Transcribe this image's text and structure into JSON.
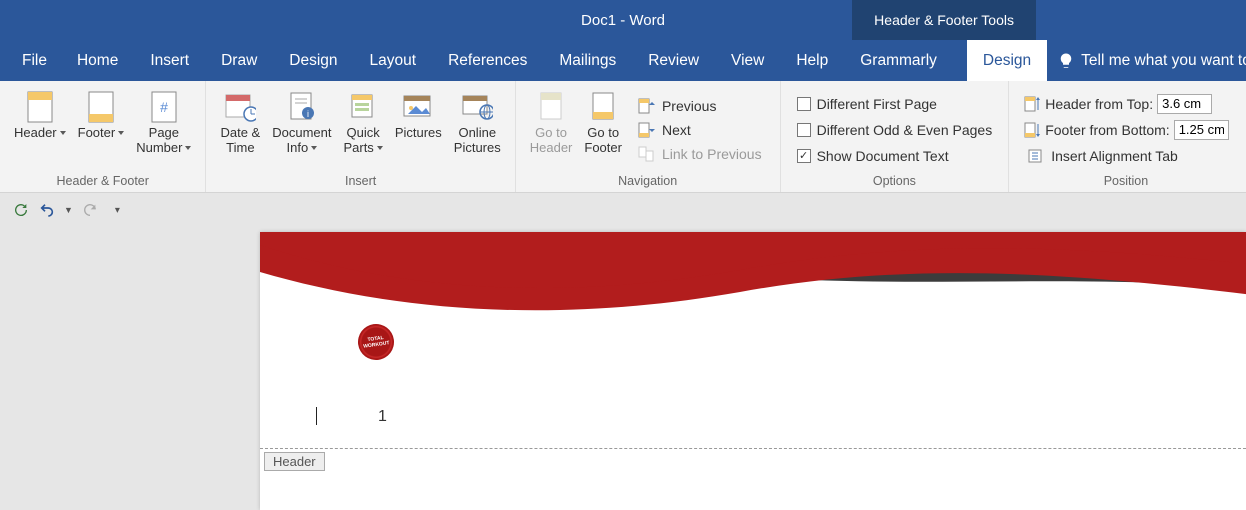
{
  "title": "Doc1  -  Word",
  "contextual_tab": "Header & Footer Tools",
  "tabs": {
    "file": "File",
    "home": "Home",
    "insert": "Insert",
    "draw": "Draw",
    "design": "Design",
    "layout": "Layout",
    "references": "References",
    "mailings": "Mailings",
    "review": "Review",
    "view": "View",
    "help": "Help",
    "grammarly": "Grammarly",
    "design_ctx": "Design",
    "tell_me": "Tell me what you want to"
  },
  "ribbon": {
    "header_footer": {
      "label": "Header & Footer",
      "header": "Header",
      "footer": "Footer",
      "page_number": "Page\nNumber"
    },
    "insert": {
      "label": "Insert",
      "date_time": "Date &\nTime",
      "doc_info": "Document\nInfo",
      "quick_parts": "Quick\nParts",
      "pictures": "Pictures",
      "online_pictures": "Online\nPictures"
    },
    "navigation": {
      "label": "Navigation",
      "go_header": "Go to\nHeader",
      "go_footer": "Go to\nFooter",
      "previous": "Previous",
      "next": "Next",
      "link_prev": "Link to Previous"
    },
    "options": {
      "label": "Options",
      "diff_first": "Different First Page",
      "diff_odd": "Different Odd & Even Pages",
      "show_doc": "Show Document Text"
    },
    "position": {
      "label": "Position",
      "hdr_top": "Header from Top:",
      "hdr_top_val": "3.6 cm",
      "ftr_bot": "Footer from Bottom:",
      "ftr_bot_val": "1.25 cm",
      "insert_align": "Insert Alignment Tab"
    }
  },
  "doc": {
    "page_number": "1",
    "header_tag": "Header",
    "badge_text": "TOTAL\nWORKOUT"
  }
}
